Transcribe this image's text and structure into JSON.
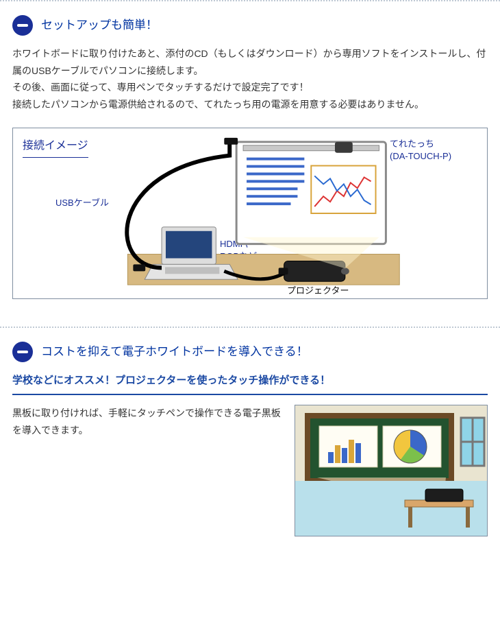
{
  "section1": {
    "title": "セットアップも簡単！",
    "para1": "ホワイトボードに取り付けたあと、添付のCD（もしくはダウンロード）から専用ソフトをインストールし、付属のUSBケーブルでパソコンに接続します。",
    "para2": "その後、画面に従って、専用ペンでタッチするだけで設定完了です！",
    "para3": "接続したパソコンから電源供給されるので、てれたっち用の電源を用意する必要はありません。",
    "diagram": {
      "title": "接続イメージ",
      "usb": "USBケーブル",
      "hdmi": "HDMIや\nRGBなど",
      "projector": "プロジェクター",
      "device_line1": "てれたっち",
      "device_line2": "(DA-TOUCH-P)"
    }
  },
  "section2": {
    "title": "コストを抑えて電子ホワイトボードを導入できる！",
    "subhead": "学校などにオススメ！プロジェクターを使ったタッチ操作ができる！",
    "body": "黒板に取り付ければ、手軽にタッチペンで操作できる電子黒板を導入できます。"
  },
  "chart_data": {
    "type": "line",
    "title": "",
    "xlabel": "",
    "ylabel": "",
    "note": "Decorative sample chart inside projected whiteboard image; values estimated from pixels.",
    "x": [
      0,
      1,
      2,
      3,
      4,
      5,
      6,
      7,
      8,
      9
    ],
    "series": [
      {
        "name": "red",
        "values": [
          20,
          35,
          25,
          40,
          30,
          55,
          40,
          65,
          55,
          75
        ]
      },
      {
        "name": "blue",
        "values": [
          60,
          45,
          55,
          35,
          50,
          30,
          45,
          25,
          40,
          20
        ]
      }
    ],
    "ylim": [
      0,
      100
    ]
  }
}
